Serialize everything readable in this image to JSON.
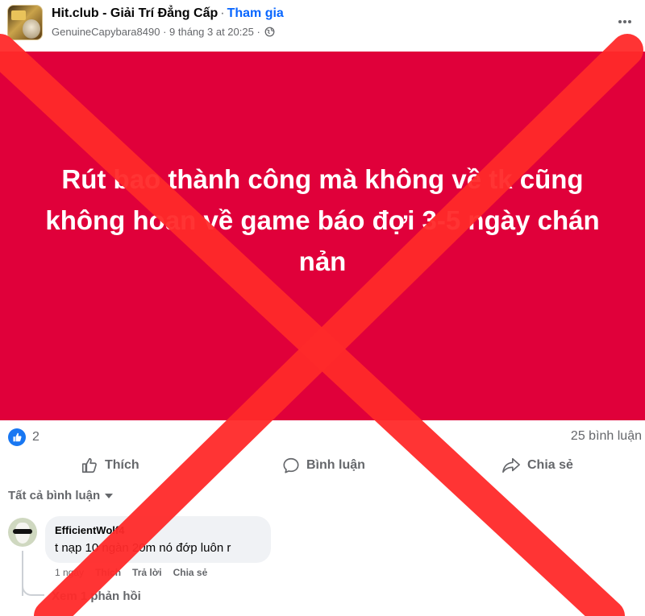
{
  "post": {
    "group_name": "Hit.club - Giải Trí Đẳng Cấp",
    "separator": "·",
    "join_label": "Tham gia",
    "author": "GenuineCapybara8490",
    "timestamp": "9 tháng 3 at 20:25",
    "privacy_icon": "globe-icon",
    "more_icon": "more-horizontal-icon",
    "body_text": "Rút bao thành công mà không về tk cũng không hoan về game báo đợi 3-5 ngày chán nản",
    "background_color": "#e0003a"
  },
  "stats": {
    "reaction_icon": "like-icon",
    "reaction_count": "2",
    "comment_count": "25 bình luận"
  },
  "actions": {
    "like_label": "Thích",
    "comment_label": "Bình luận",
    "share_label": "Chia sẻ"
  },
  "comments": {
    "filter_label": "Tất cả bình luận",
    "items": [
      {
        "author": "EfficientWolf4",
        "text": "t nạp 10 ngàn 20m nó đớp luôn r",
        "time": "1 ngày",
        "like_label": "Thích",
        "reply_label": "Trả lời",
        "share_label": "Chia sẻ"
      }
    ],
    "view_replies_label": "Xem 1 phản hồi"
  },
  "overlay": {
    "mark": "red-x-cross",
    "color": "#ff2a2a"
  }
}
